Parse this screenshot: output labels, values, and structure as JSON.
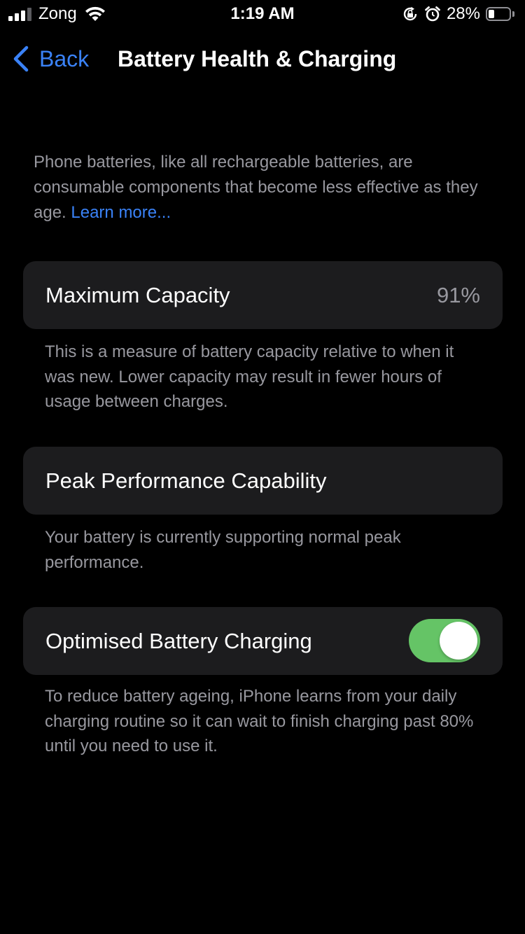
{
  "status_bar": {
    "carrier": "Zong",
    "time": "1:19 AM",
    "battery_percent": "28%",
    "battery_level": 0.28,
    "signal_bars": 3,
    "icons": [
      "signal-icon",
      "wifi-icon",
      "orientation-lock-icon",
      "alarm-icon",
      "battery-icon"
    ]
  },
  "nav": {
    "back_label": "Back",
    "title": "Battery Health & Charging"
  },
  "intro": {
    "text": "Phone batteries, like all rechargeable batteries, are consumable components that become less effective as they age.",
    "link": "Learn more..."
  },
  "maximum_capacity": {
    "label": "Maximum Capacity",
    "value": "91%",
    "footer": "This is a measure of battery capacity relative to when it was new. Lower capacity may result in fewer hours of usage between charges."
  },
  "peak_performance": {
    "label": "Peak Performance Capability",
    "footer": "Your battery is currently supporting normal peak performance."
  },
  "optimised_charging": {
    "label": "Optimised Battery Charging",
    "enabled": true,
    "footer": "To reduce battery ageing, iPhone learns from your daily charging routine so it can wait to finish charging past 80% until you need to use it."
  },
  "colors": {
    "background": "#000000",
    "cell_background": "#1c1c1e",
    "secondary_text": "#98989f",
    "accent_blue": "#3a82f7",
    "toggle_on": "#65c466"
  }
}
